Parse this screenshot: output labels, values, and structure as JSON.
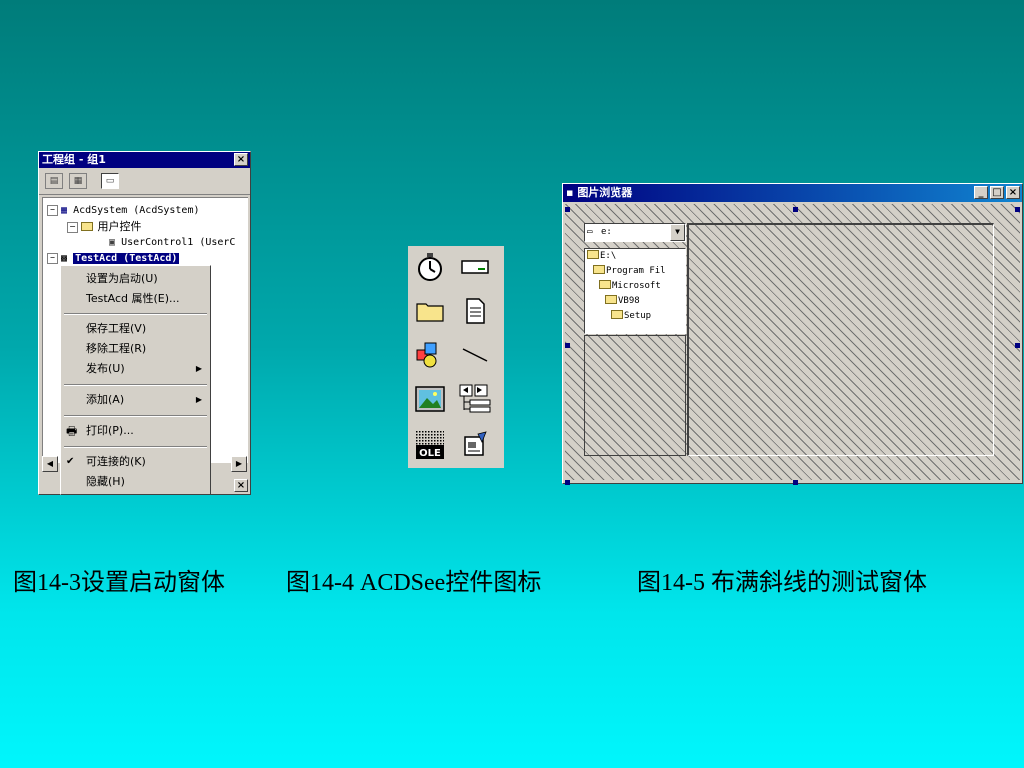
{
  "project_window": {
    "title": "工程组 - 组1",
    "close_label": "×",
    "tree": [
      {
        "expander": "−",
        "label": "AcdSystem (AcdSystem)"
      },
      {
        "expander": "−",
        "label": "用户控件"
      },
      {
        "expander": "",
        "label": "UserControl1 (UserC"
      },
      {
        "expander": "−",
        "label": "TestAcd (TestAcd)"
      }
    ],
    "bottom_close": "×"
  },
  "context_menu": {
    "items": [
      {
        "label": "设置为启动(U)",
        "arrow": "",
        "icon": ""
      },
      {
        "label": "TestAcd 属性(E)...",
        "arrow": "",
        "icon": ""
      },
      {
        "label": "保存工程(V)",
        "arrow": "",
        "icon": ""
      },
      {
        "label": "移除工程(R)",
        "arrow": "",
        "icon": ""
      },
      {
        "label": "发布(U)",
        "arrow": "▶",
        "icon": ""
      },
      {
        "label": "添加(A)",
        "arrow": "▶",
        "icon": ""
      },
      {
        "label": "打印(P)...",
        "arrow": "",
        "icon": "🖶"
      },
      {
        "label": "可连接的(K)",
        "arrow": "",
        "icon": "✔"
      },
      {
        "label": "隐藏(H)",
        "arrow": "",
        "icon": ""
      }
    ]
  },
  "toolbox": {
    "ole_label": "OLE"
  },
  "browser_window": {
    "title": "图片浏览器",
    "min_label": "_",
    "max_label": "□",
    "close_label": "×",
    "drive_value": "e:",
    "dir_items": [
      "E:\\",
      "Program Fil",
      "Microsoft",
      "VB98",
      "Setup"
    ]
  },
  "captions": {
    "fig3": "图14-3设置启动窗体",
    "fig4": "图14-4  ACDSee控件图标",
    "fig5": "图14-5  布满斜线的测试窗体"
  }
}
